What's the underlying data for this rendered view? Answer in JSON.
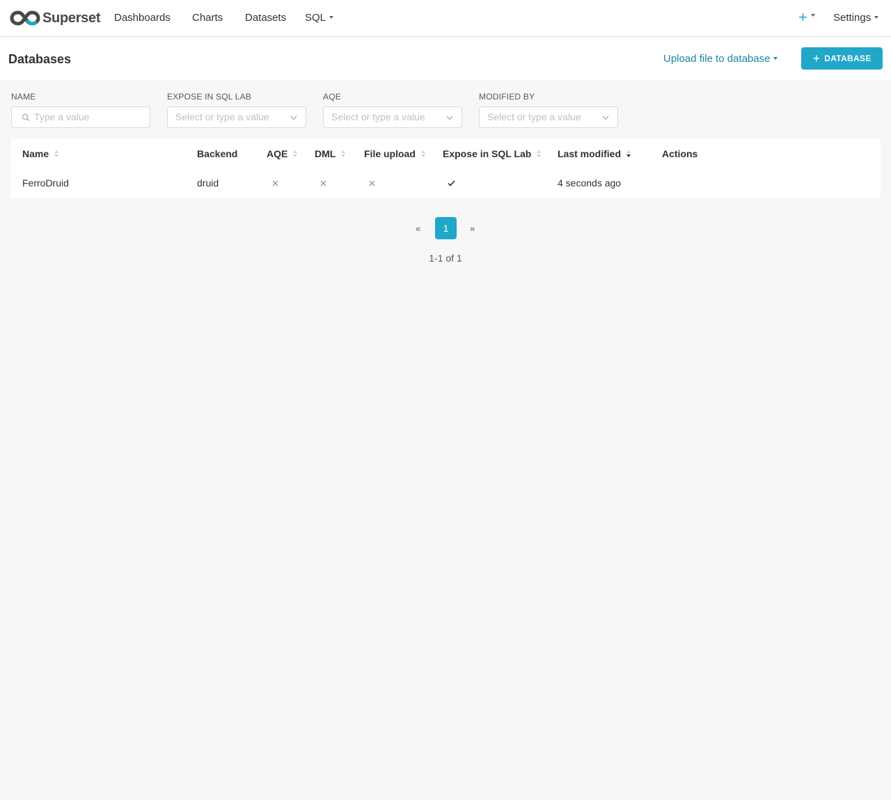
{
  "app": {
    "name": "Superset"
  },
  "nav": {
    "items": [
      {
        "label": "Dashboards"
      },
      {
        "label": "Charts"
      },
      {
        "label": "Datasets"
      },
      {
        "label": "SQL"
      }
    ],
    "plus_label": "+",
    "settings_label": "Settings"
  },
  "subheader": {
    "title": "Databases",
    "upload_label": "Upload file to database",
    "add_button_plus": "+",
    "add_button_label": "DATABASE"
  },
  "filters": [
    {
      "label": "NAME",
      "placeholder": "Type a value"
    },
    {
      "label": "EXPOSE IN SQL LAB",
      "placeholder": "Select or type a value"
    },
    {
      "label": "AQE",
      "placeholder": "Select or type a value"
    },
    {
      "label": "MODIFIED BY",
      "placeholder": "Select or type a value"
    }
  ],
  "table": {
    "columns": [
      {
        "label": "Name",
        "sortable": true
      },
      {
        "label": "Backend",
        "sortable": false
      },
      {
        "label": "AQE",
        "sortable": true
      },
      {
        "label": "DML",
        "sortable": true
      },
      {
        "label": "File upload",
        "sortable": true
      },
      {
        "label": "Expose in SQL Lab",
        "sortable": true
      },
      {
        "label": "Last modified",
        "sortable": true,
        "sorted": "descending"
      },
      {
        "label": "Actions",
        "sortable": false
      }
    ],
    "rows": [
      {
        "name": "FerroDruid",
        "backend": "druid",
        "aqe": "close-icon",
        "dml": "close-icon",
        "file_upload": "close-icon",
        "expose_in_sql_lab": "check-icon",
        "last_modified": "4 seconds ago"
      }
    ]
  },
  "pagination": {
    "prev": "«",
    "current": "1",
    "next": "»",
    "summary": "1-1 of 1"
  },
  "colors": {
    "primary": "#20a7c9",
    "link": "#1a85a0",
    "background": "#f7f7f7"
  }
}
